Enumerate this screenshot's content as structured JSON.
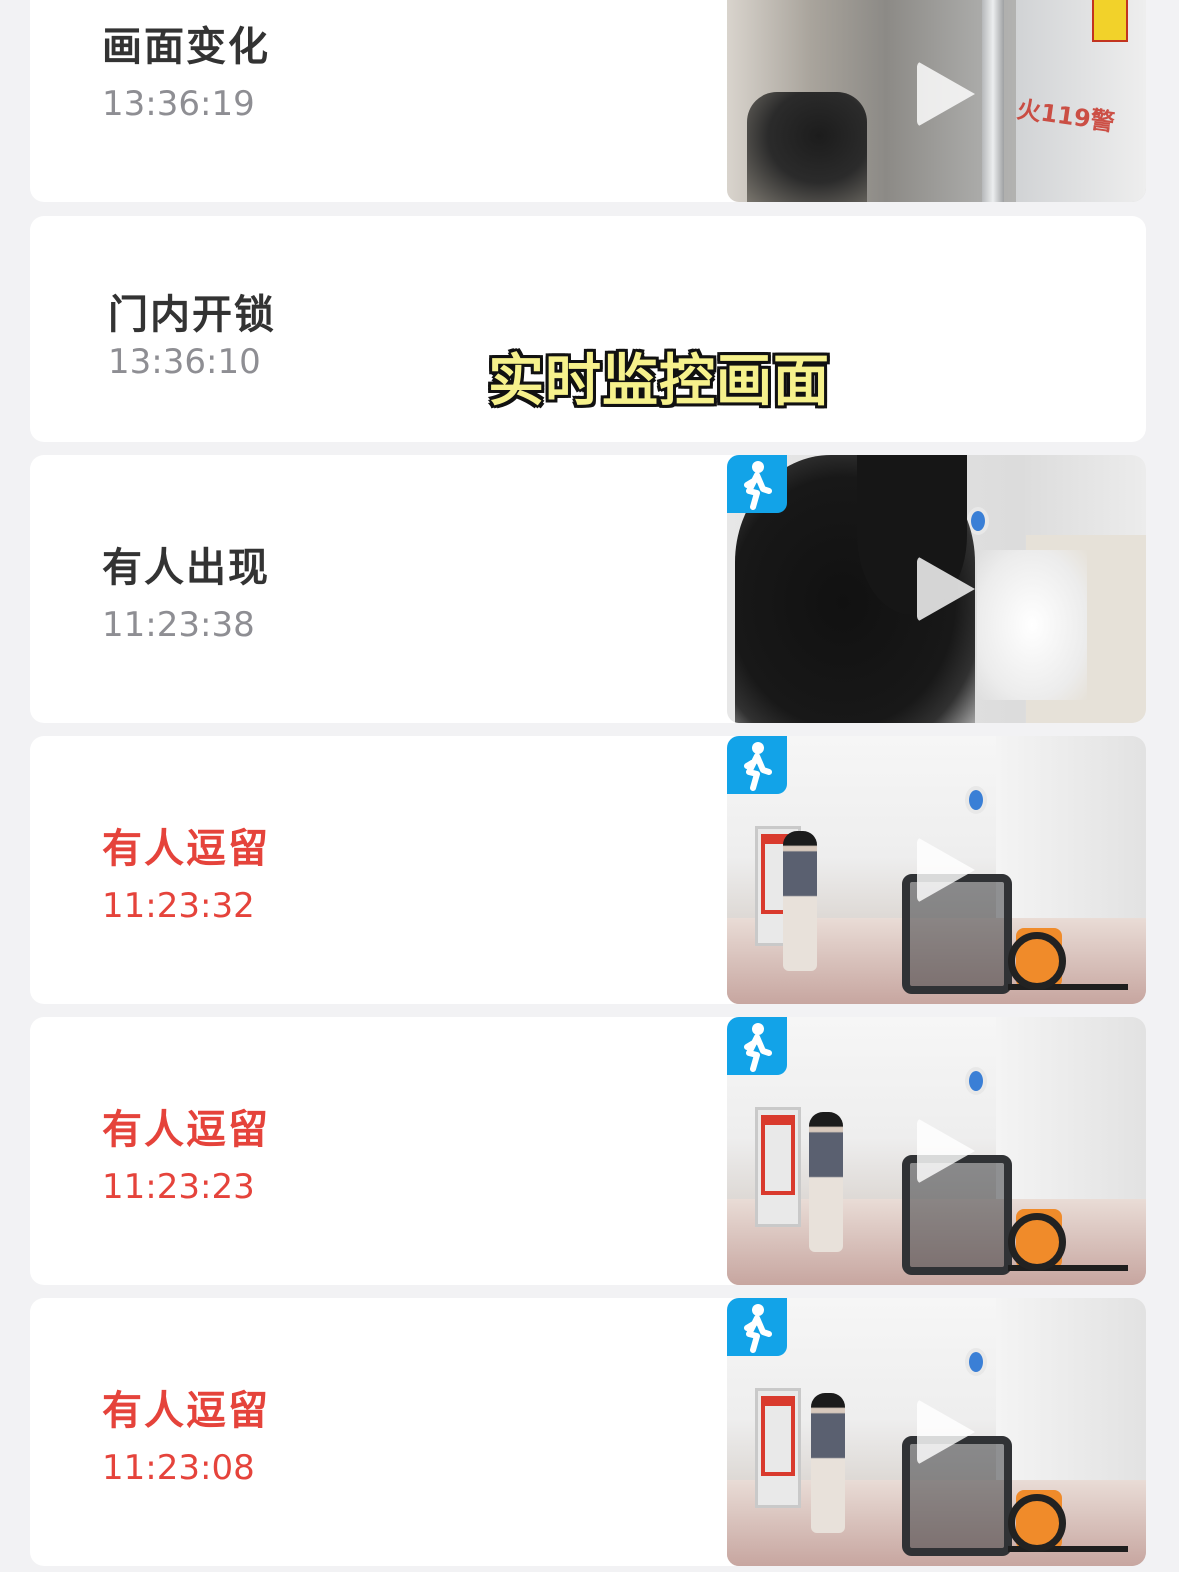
{
  "events": [
    {
      "title": "画面变化",
      "time": "13:36:19",
      "alert": false,
      "has_thumbnail": true,
      "person_badge": false
    },
    {
      "title": "门内开锁",
      "time": "13:36:10",
      "alert": false,
      "has_thumbnail": false,
      "person_badge": false
    },
    {
      "title": "有人出现",
      "time": "11:23:38",
      "alert": false,
      "has_thumbnail": true,
      "person_badge": true
    },
    {
      "title": "有人逗留",
      "time": "11:23:32",
      "alert": true,
      "has_thumbnail": true,
      "person_badge": true
    },
    {
      "title": "有人逗留",
      "time": "11:23:23",
      "alert": true,
      "has_thumbnail": true,
      "person_badge": true
    },
    {
      "title": "有人逗留",
      "time": "11:23:08",
      "alert": true,
      "has_thumbnail": true,
      "person_badge": true
    }
  ],
  "thumbnail_overlay_text": "火119警",
  "subtitle": "实时监控画面",
  "colors": {
    "alert": "#e5433b",
    "normal_title": "#333333",
    "normal_time": "#8e8e93",
    "badge": "#12a3e8",
    "subtitle": "#f6f18c"
  },
  "icons": {
    "play": "play-icon",
    "person_badge": "person-walking-icon"
  }
}
